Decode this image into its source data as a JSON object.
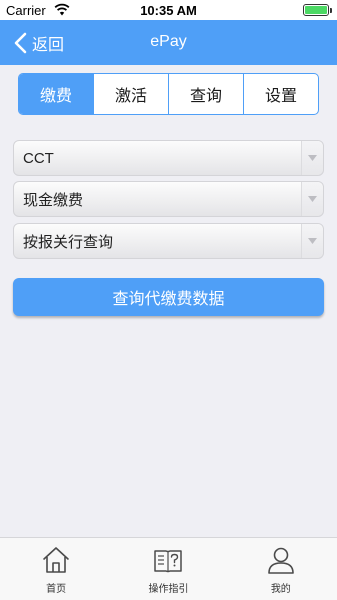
{
  "status_bar": {
    "carrier": "Carrier",
    "time": "10:35 AM",
    "battery_level": 1.0
  },
  "nav": {
    "back_label": "返回",
    "title": "ePay"
  },
  "segments": [
    {
      "label": "缴费",
      "active": true
    },
    {
      "label": "激活",
      "active": false
    },
    {
      "label": "查询",
      "active": false
    },
    {
      "label": "设置",
      "active": false
    }
  ],
  "selects": [
    {
      "value": "CCT"
    },
    {
      "value": "现金缴费"
    },
    {
      "value": "按报关行查询"
    }
  ],
  "query_button_label": "查询代缴费数据",
  "tabbar": [
    {
      "label": "首页",
      "icon": "home-icon"
    },
    {
      "label": "操作指引",
      "icon": "guide-book-icon"
    },
    {
      "label": "我的",
      "icon": "user-icon"
    }
  ],
  "colors": {
    "accent": "#4f9ff7",
    "background": "#efeff4",
    "battery": "#4cd964"
  }
}
